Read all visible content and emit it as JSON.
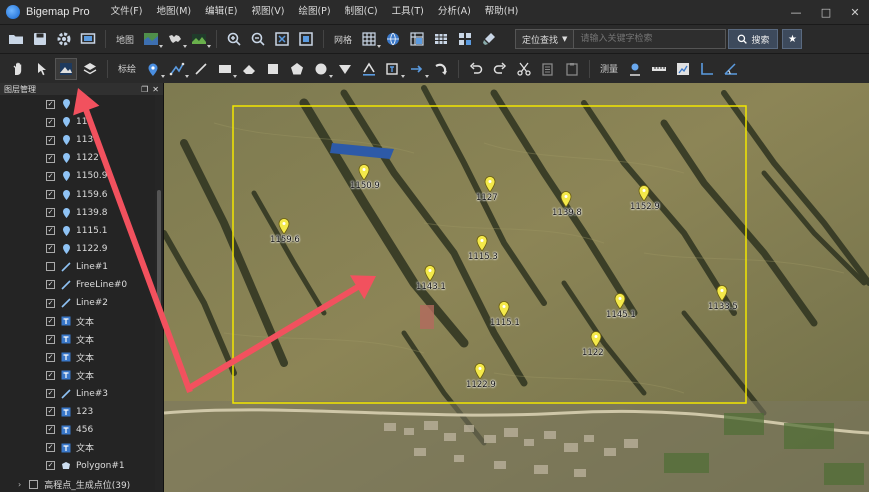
{
  "app": {
    "title": "Bigemap Pro"
  },
  "menu": [
    "文件(F)",
    "地图(M)",
    "编辑(E)",
    "视图(V)",
    "绘图(P)",
    "制图(C)",
    "工具(T)",
    "分析(A)",
    "帮助(H)"
  ],
  "toolbar1": {
    "map_label": "地图",
    "grid_label": "网格"
  },
  "search": {
    "mode_label": "定位查找",
    "placeholder": "请输入关键字检索",
    "button_label": "搜索"
  },
  "toolbar2": {
    "mark_label": "标绘",
    "measure_label": "测量"
  },
  "layer_panel": {
    "title": "图层管理",
    "items": [
      {
        "label": "1",
        "type": "point",
        "checked": true
      },
      {
        "label": "11",
        "type": "point",
        "checked": true
      },
      {
        "label": "113",
        "type": "point",
        "checked": true
      },
      {
        "label": "1122",
        "type": "point",
        "checked": true
      },
      {
        "label": "1150.9",
        "type": "point",
        "checked": true
      },
      {
        "label": "1159.6",
        "type": "point",
        "checked": true
      },
      {
        "label": "1139.8",
        "type": "point",
        "checked": true
      },
      {
        "label": "1115.1",
        "type": "point",
        "checked": true
      },
      {
        "label": "1122.9",
        "type": "point",
        "checked": true
      },
      {
        "label": "Line#1",
        "type": "line",
        "checked": false
      },
      {
        "label": "FreeLine#0",
        "type": "line",
        "checked": true
      },
      {
        "label": "Line#2",
        "type": "line",
        "checked": true
      },
      {
        "label": "文本",
        "type": "text",
        "checked": true
      },
      {
        "label": "文本",
        "type": "text",
        "checked": true
      },
      {
        "label": "文本",
        "type": "text",
        "checked": true
      },
      {
        "label": "文本",
        "type": "text",
        "checked": true
      },
      {
        "label": "Line#3",
        "type": "line",
        "checked": true
      },
      {
        "label": "123",
        "type": "text",
        "checked": true
      },
      {
        "label": "456",
        "type": "text",
        "checked": true
      },
      {
        "label": "文本",
        "type": "text",
        "checked": true
      },
      {
        "label": "Polygon#1",
        "type": "polygon",
        "checked": true
      }
    ],
    "group": {
      "label": "高程点_生成点位(39)"
    }
  },
  "map": {
    "markers": [
      {
        "label": "1150.9"
      },
      {
        "label": "1127"
      },
      {
        "label": "1139.8"
      },
      {
        "label": "1152.9"
      },
      {
        "label": "1159.6"
      },
      {
        "label": "1115.3"
      },
      {
        "label": "1143.1"
      },
      {
        "label": "1133.5"
      },
      {
        "label": "1145.1"
      },
      {
        "label": "1115.1"
      },
      {
        "label": "1122"
      },
      {
        "label": "1122.9"
      }
    ]
  },
  "colors": {
    "selection": "#f2e600",
    "arrow": "#f2515e",
    "marker": "#f4e94a"
  }
}
